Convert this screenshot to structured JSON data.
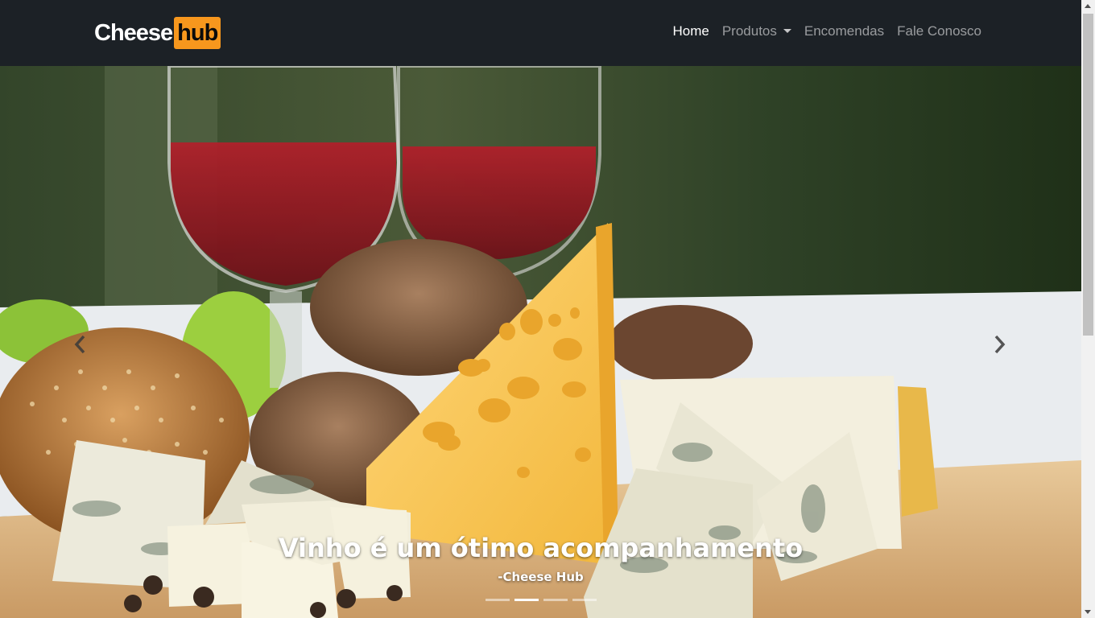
{
  "brand": {
    "part1": "Cheese",
    "part2": "hub"
  },
  "nav": {
    "items": [
      {
        "label": "Home",
        "active": true
      },
      {
        "label": "Produtos",
        "dropdown": true
      },
      {
        "label": "Encomendas"
      },
      {
        "label": "Fale Conosco"
      }
    ]
  },
  "carousel": {
    "title": "Vinho é um ótimo acompanhamento",
    "subtitle": "-Cheese Hub",
    "slide_count": 4,
    "active_index": 1,
    "prev_icon": "chevron-left-icon",
    "next_icon": "chevron-right-icon"
  },
  "colors": {
    "navbar_bg": "#1c2126",
    "brand_accent": "#f7971d"
  }
}
